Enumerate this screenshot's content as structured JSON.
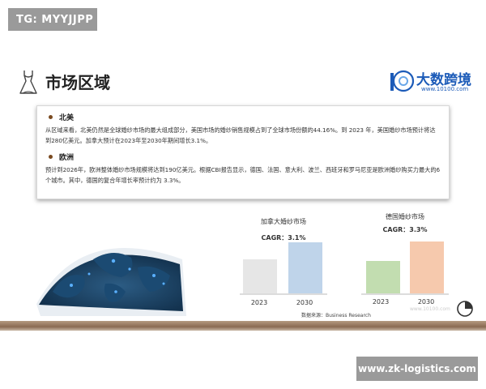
{
  "watermark_top": "TG: MYYJJPP",
  "watermark_bottom": "www.zk-logistics.com",
  "watermark_mid": "www.10100.com",
  "header": {
    "title": "市场区域",
    "logo_name": "大数跨境",
    "logo_mark": "10",
    "logo_url": "www.10100.com"
  },
  "sections": [
    {
      "heading": "北美",
      "body": "从区域来看，北美仍然是全球婚纱市场的最大组成部分，美国市场的婚纱销售规模占到了全球市场份额的44.16%。到 2023 年，美国婚纱市场预计将达到280亿美元。加拿大预计在2023年至2030年期间增长3.1%。"
    },
    {
      "heading": "欧洲",
      "body": "预计到2026年，欧洲整体婚纱市场规模将达到190亿美元。根据CBI报告显示，德国、法国、意大利、波兰、西班牙和罗马尼亚是欧洲婚纱购买力最大的6个城市。其中，德国的复合年增长率预计约为 3.3%。"
    }
  ],
  "charts": [
    {
      "title": "加拿大婚纱市场",
      "cagr": "CAGR：3.1%",
      "years": [
        "2023",
        "2030"
      ],
      "values": [
        1.0,
        1.5
      ],
      "colors": [
        "#e6e6e6",
        "#bfd4ea"
      ]
    },
    {
      "title": "德国婚纱市场",
      "cagr": "CAGR：3.3%",
      "years": [
        "2023",
        "2030"
      ],
      "values": [
        1.0,
        1.6
      ],
      "colors": [
        "#c2ddb0",
        "#f6c9ad"
      ]
    }
  ],
  "source": "数据来源：Business Research",
  "icons": {
    "dress": "wedding-dress-icon",
    "pie": "pie-chart-icon",
    "globe": "world-globe-image"
  }
}
